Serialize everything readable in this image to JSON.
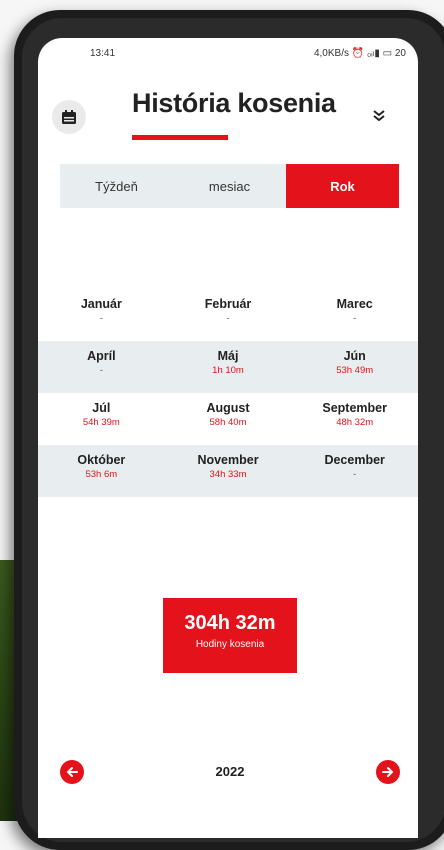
{
  "status_bar": {
    "time": "13:41",
    "indicators": "4,0KB/s ⏰ ₀ᵢₗ▮ ▭ 20"
  },
  "header": {
    "title": "História kosenia",
    "calendar_icon": "calendar-icon",
    "chevron_icon": "double-chevron-down-icon"
  },
  "tabs": [
    {
      "label": "Týždeň",
      "active": false
    },
    {
      "label": "mesiac",
      "active": false
    },
    {
      "label": "Rok",
      "active": true
    }
  ],
  "months": [
    {
      "name": "Január",
      "value": "-"
    },
    {
      "name": "Február",
      "value": "-"
    },
    {
      "name": "Marec",
      "value": "-"
    },
    {
      "name": "Apríl",
      "value": "-"
    },
    {
      "name": "Máj",
      "value": "1h 10m"
    },
    {
      "name": "Jún",
      "value": "53h 49m"
    },
    {
      "name": "Júl",
      "value": "54h 39m"
    },
    {
      "name": "August",
      "value": "58h 40m"
    },
    {
      "name": "September",
      "value": "48h 32m"
    },
    {
      "name": "Október",
      "value": "53h 6m"
    },
    {
      "name": "November",
      "value": "34h 33m"
    },
    {
      "name": "December",
      "value": "-"
    }
  ],
  "total": {
    "value": "304h 32m",
    "label": "Hodiny kosenia"
  },
  "navigation": {
    "year": "2022"
  },
  "colors": {
    "accent": "#e3121b",
    "shade": "#e8edf0"
  }
}
